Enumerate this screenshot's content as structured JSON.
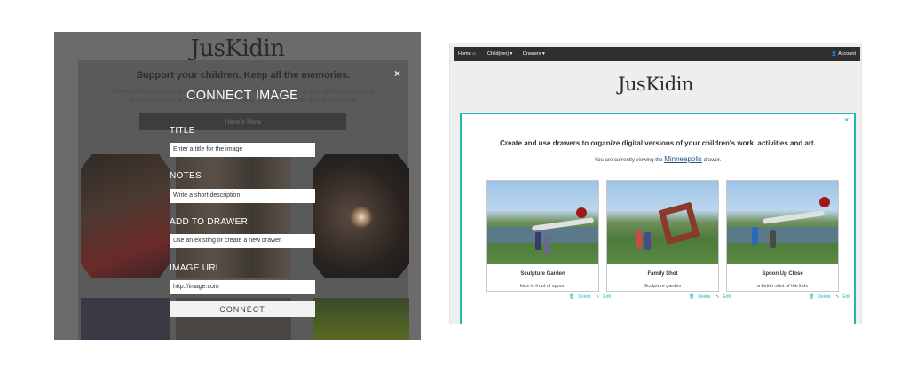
{
  "left": {
    "logo": "JusKidin",
    "support_heading": "Support your children. Keep all the memories.",
    "description": "Create profiles for each of your children and organize pictures based on your child's age. Upload pictures you take of your children's art, school projects and other special memories.",
    "how_button": "Here's How",
    "close_label": "×",
    "form": {
      "heading": "CONNECT IMAGE",
      "title_label": "TITLE",
      "title_placeholder": "Enter a title for the image",
      "notes_label": "NOTES",
      "notes_placeholder": "Write a short description.",
      "drawer_label": "ADD TO DRAWER",
      "drawer_placeholder": "Use an existing or create a new drawer.",
      "url_label": "IMAGE URL",
      "url_placeholder": "http://image.com",
      "connect_button": "CONNECT"
    }
  },
  "right": {
    "nav": {
      "home": "Home ⌂",
      "children": "Child(ren) ▾",
      "drawers": "Drawers ▾",
      "account": "👤 Account"
    },
    "logo": "JusKidin",
    "close_label": "×",
    "headline": "Create and use drawers to organize digital versions of your children's work, activities and art.",
    "viewing_prefix": "You are currently viewing the",
    "viewing_drawer": "Minneapolis",
    "viewing_suffix": "drawer.",
    "tiles": [
      {
        "title": "Sculpture Garden",
        "note": "kids in front of spoon",
        "delete": "Delete",
        "edit": "Edit"
      },
      {
        "title": "Family Shot",
        "note": "Sculpture garden",
        "delete": "Delete",
        "edit": "Edit"
      },
      {
        "title": "Spoon Up Close",
        "note": "a better shot of the kids",
        "delete": "Delete",
        "edit": "Edit"
      }
    ]
  },
  "colors": {
    "accent": "#26b5b5",
    "navbar": "#2f2f2f",
    "overlay": "#6b6b6b"
  }
}
